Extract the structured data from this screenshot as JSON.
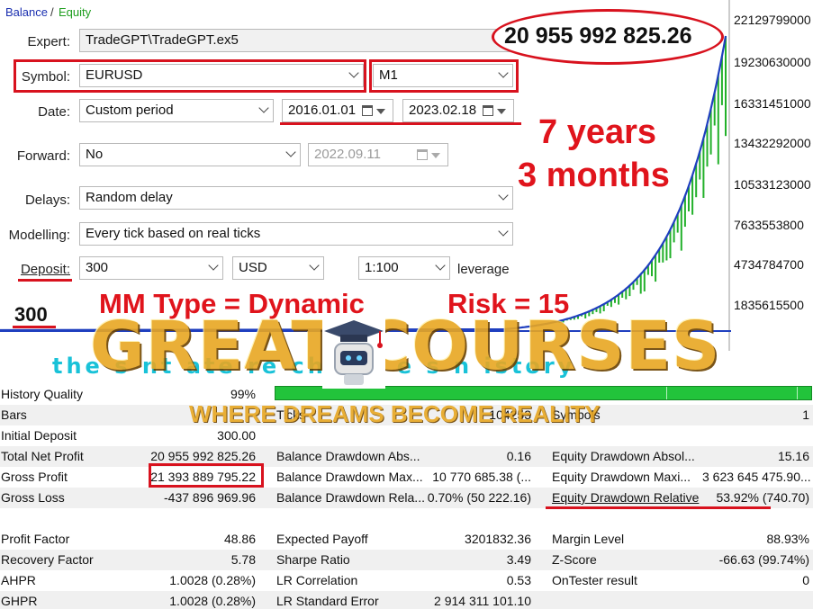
{
  "tabs": {
    "balance": "Balance",
    "separator": "/",
    "equity": "Equity"
  },
  "settings": {
    "expert_label": "Expert:",
    "expert_value": "TradeGPT\\TradeGPT.ex5",
    "symbol_label": "Symbol:",
    "symbol_value": "EURUSD",
    "timeframe": "M1",
    "date_label": "Date:",
    "date_mode": "Custom period",
    "date_from": "2016.01.01",
    "date_to": "2023.02.18",
    "forward_label": "Forward:",
    "forward_value": "No",
    "forward_date": "2022.09.11",
    "delays_label": "Delays:",
    "delays_value": "Random delay",
    "modelling_label": "Modelling:",
    "modelling_value": "Every tick based on real ticks",
    "deposit_label": "Deposit:",
    "deposit_value": "300",
    "currency": "USD",
    "leverage_value": "1:100",
    "leverage_label": "leverage"
  },
  "annotations": {
    "final_balance": "20 955 992 825.26",
    "years": "7 years",
    "months": "3 months",
    "mm_type": "MM Type = Dynamic",
    "risk": "Risk = 15",
    "start_deposit": "300"
  },
  "chart": {
    "y_ticks": [
      "22129799000",
      "19230630000",
      "16331451000",
      "13432292000",
      "10533123000",
      "7633553800",
      "4734784700",
      "1835615500"
    ],
    "colors": {
      "balance": "#1f3fbf",
      "equity": "#22b02a"
    }
  },
  "watermark": {
    "title": "GREAT COURSES",
    "subtitle": "WHERE DREAMS BECOME REALITY",
    "cyan_text": "the     s     nt     ate     re    ch    d     v    e s     n    istory"
  },
  "results": {
    "history_quality_label": "History Quality",
    "history_quality_value": "99%",
    "bars_label": "Bars",
    "ticks_label": "Ticks",
    "ticks_value": "104253",
    "symbols_label": "Symbols",
    "symbols_value": "1",
    "initial_deposit_label": "Initial Deposit",
    "initial_deposit_value": "300.00",
    "rows": [
      {
        "l1": "Total Net Profit",
        "v1": "20 955 992 825.26",
        "l2": "Balance Drawdown Abs...",
        "v2": "0.16",
        "l3": "Equity Drawdown Absol...",
        "v3": "15.16"
      },
      {
        "l1": "Gross Profit",
        "v1": "21 393 889 795.22",
        "l2": "Balance Drawdown Max...",
        "v2": "10 770 685.38 (...",
        "l3": "Equity Drawdown Maxi...",
        "v3": "3 623 645 475.90..."
      },
      {
        "l1": "Gross Loss",
        "v1": "-437 896 969.96",
        "l2": "Balance Drawdown Rela...",
        "v2": "0.70% (50 222.16)",
        "l3": "Equity Drawdown Relative",
        "v3": "53.92% (740.70)"
      }
    ],
    "rows2": [
      {
        "l1": "Profit Factor",
        "v1": "48.86",
        "l2": "Expected Payoff",
        "v2": "3201832.36",
        "l3": "Margin Level",
        "v3": "88.93%"
      },
      {
        "l1": "Recovery Factor",
        "v1": "5.78",
        "l2": "Sharpe Ratio",
        "v2": "3.49",
        "l3": "Z-Score",
        "v3": "-66.63 (99.74%)"
      },
      {
        "l1": "AHPR",
        "v1": "1.0028 (0.28%)",
        "l2": "LR Correlation",
        "v2": "0.53",
        "l3": "OnTester result",
        "v3": "0"
      },
      {
        "l1": "GHPR",
        "v1": "1.0028 (0.28%)",
        "l2": "LR Standard Error",
        "v2": "2 914 311 101.10",
        "l3": "",
        "v3": ""
      }
    ]
  }
}
